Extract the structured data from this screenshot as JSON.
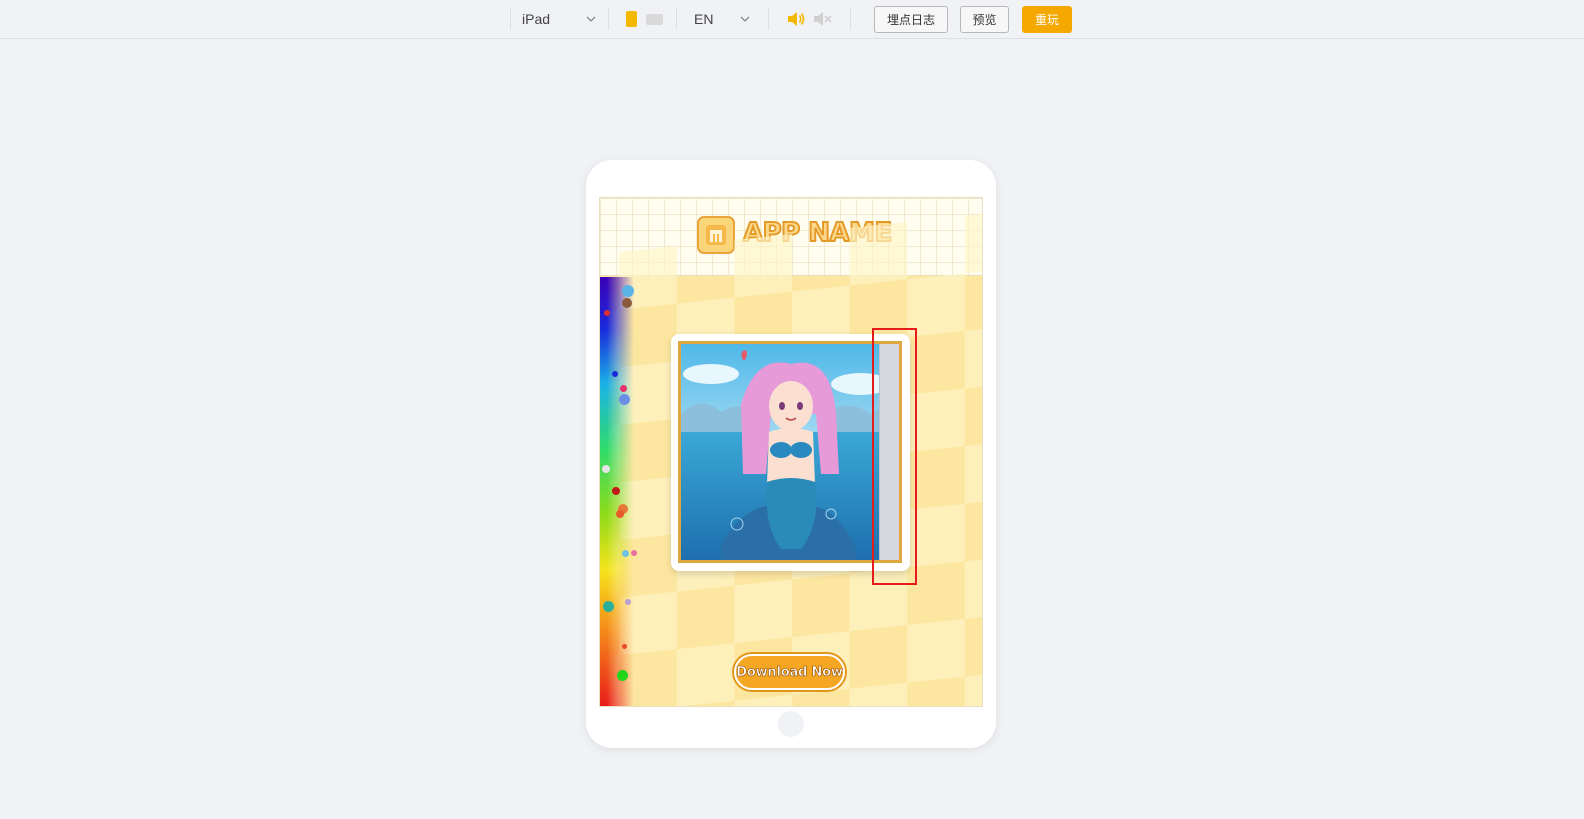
{
  "toolbar": {
    "device": "iPad",
    "language": "EN",
    "log_button": "埋点日志",
    "preview_button": "预览",
    "replay_button": "重玩",
    "accent_color": "#f5a800"
  },
  "ad": {
    "app_name": "APP NAME",
    "download_button": "Download Now",
    "icons": [
      "app-logo-icon"
    ],
    "colors": {
      "header_bg": "#fffdf0",
      "play_bg": "#fde7a0",
      "button": "#f5a623",
      "highlight_box": "#e51c1c"
    }
  }
}
